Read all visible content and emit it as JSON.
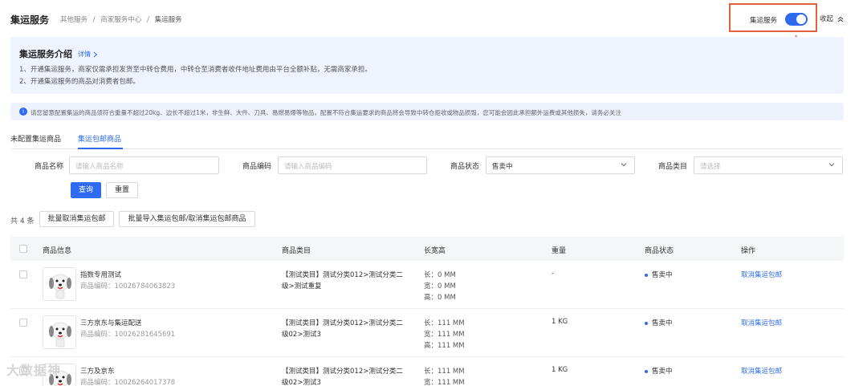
{
  "header": {
    "title": "集运服务",
    "breadcrumb": [
      "其他服务",
      "/",
      "商家服务中心",
      "/",
      "集运服务"
    ],
    "service_label": "集运服务",
    "toggle_on": true,
    "collapse_label": "收起"
  },
  "intro": {
    "title": "集运服务介绍",
    "detail_link": "详情",
    "lines": [
      "1、开通集运服务，商家仅需承担发货至中转仓费用，中转仓至消费者收件地址费用由平台全额补贴，无需商家承担。",
      "2、开通集运服务的商品对消费者包邮。"
    ]
  },
  "notice": {
    "text": "请您留意配置集运的商品须符合重量不超过20kg、边长不超过1米，非生鲜、大件、刀具、易燃易爆等物品，配置不符合集运要求的商品将会导致中转仓拒收或物品损毁，您可能会因此承担额外运费或其他损失，请务必关注"
  },
  "tabs": [
    {
      "label": "未配置集运商品",
      "active": false
    },
    {
      "label": "集运包邮商品",
      "active": true
    }
  ],
  "filters": {
    "name_label": "商品名称",
    "name_placeholder": "请输入商品名称",
    "code_label": "商品编码",
    "code_placeholder": "请输入商品编码",
    "status_label": "商品状态",
    "status_value": "售卖中",
    "category_label": "商品类目",
    "category_placeholder": "请选择",
    "query_button": "查询",
    "reset_button": "重置"
  },
  "toolbar": {
    "count_text": "共 4 条",
    "batch_cancel": "批量取消集运包邮",
    "batch_import": "批量导入集运包邮/取消集运包邮商品"
  },
  "table": {
    "columns": [
      "商品信息",
      "商品类目",
      "长宽高",
      "重量",
      "商品状态",
      "操作"
    ],
    "rows": [
      {
        "name": "指数专用测试",
        "code": "商品编码：10026784063823",
        "category_line1": "【测试类目】测试分类012>测试分类二",
        "category_line2": "级>测试重复",
        "length": "长：0 MM",
        "width": "宽：0 MM",
        "height": "高：0 MM",
        "weight": "-",
        "status": "售卖中",
        "action": "取消集运包邮"
      },
      {
        "name": "三方京东与集运配送",
        "code": "商品编码：10026281645691",
        "category_line1": "【测试类目】测试分类012>测试分类二",
        "category_line2": "级02>测试3",
        "length": "长：111 MM",
        "width": "宽：111 MM",
        "height": "高：111 MM",
        "weight": "1 KG",
        "status": "售卖中",
        "action": "取消集运包邮"
      },
      {
        "name": "三方及京东",
        "code": "商品编码：10026264017378",
        "category_line1": "【测试类目】测试分类012>测试分类二",
        "category_line2": "级02>测试3",
        "length": "长：111 MM",
        "width": "宽：111 MM",
        "height": "",
        "weight": "1 KG",
        "status": "售卖中",
        "action": "取消集运包邮"
      }
    ]
  },
  "watermark": "大数据神",
  "colors": {
    "accent": "#2f6bf0",
    "highlight_border": "#e0623a",
    "intro_bg": "#eef3fd"
  }
}
